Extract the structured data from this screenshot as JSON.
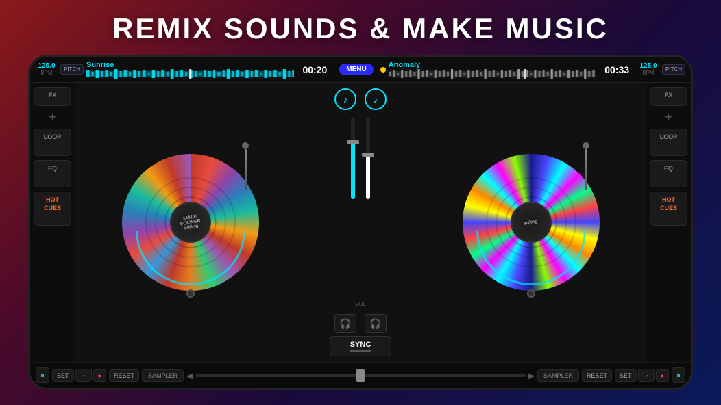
{
  "headline": "REMIX SOUNDS & MAKE MUSIC",
  "top_bar_left": {
    "bpm": "125.0",
    "bpm_label": "BPM",
    "pitch_label": "PITCH",
    "track_name": "Sunrise",
    "time": "00:20"
  },
  "top_bar_right": {
    "bpm": "125.0",
    "bpm_label": "BPM",
    "pitch_label": "PITCH",
    "track_name": "Anomaly",
    "time": "00:33"
  },
  "menu_btn": "MENU",
  "left_panel": {
    "fx": "FX",
    "loop": "LOOP",
    "eq": "EQ",
    "hot_cues": "HOT\nCUES"
  },
  "right_panel": {
    "fx": "FX",
    "loop": "LOOP",
    "eq": "EQ",
    "hot_cues": "HOT\nCUES"
  },
  "left_vinyl": {
    "label_line1": "JAMIE",
    "label_line2": "FOLWER",
    "label_logo": "edjing"
  },
  "right_vinyl": {
    "label_logo": "edjing"
  },
  "mixer": {
    "vol_label": "VOL",
    "sync_label": "SYNC",
    "headphone_icon": "🎧"
  },
  "transport_left": {
    "play": "⏸",
    "set": "SET",
    "arrow": "→",
    "dot": "●",
    "reset": "RESET",
    "sampler": "SAMPLER"
  },
  "transport_right": {
    "sampler": "SAMPLER",
    "reset": "RESET",
    "set": "SET",
    "arrow": "→",
    "dot": "●",
    "play": "⏸"
  },
  "pitch_slider": {
    "left_arrow": "◀",
    "right_arrow": "▶"
  }
}
